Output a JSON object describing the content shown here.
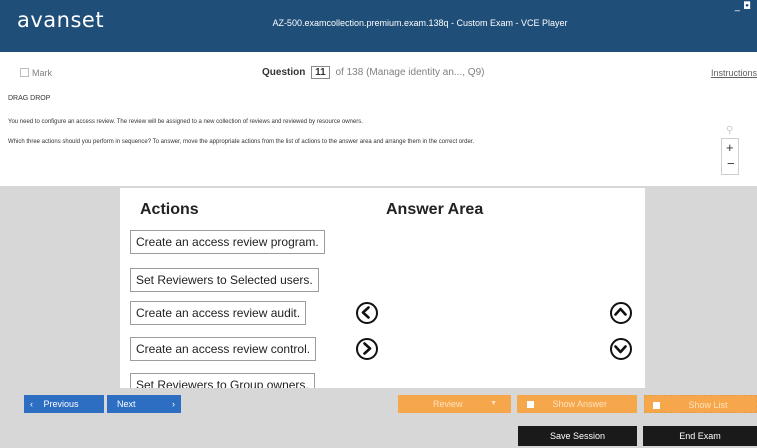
{
  "app": {
    "logo": "avanset",
    "window_title": "AZ-500.examcollection.premium.exam.138q - Custom Exam - VCE Player",
    "window_controls": "_ ◘"
  },
  "question_bar": {
    "mark_label": "Mark",
    "question_label": "Question",
    "question_number": "11",
    "question_suffix": "of 138 (Manage identity an..., Q9)",
    "instructions_label": "Instructions"
  },
  "question": {
    "type": "DRAG DROP",
    "line1": "You need to configure an access review. The review will be assigned to a new collection of reviews and reviewed by resource owners.",
    "line2": "Which three actions should you perform in sequence? To answer, move the appropriate actions from the list of actions to the answer area and arrange them in the correct order."
  },
  "zoom": {
    "search_icon": "search-icon",
    "plus": "+",
    "minus": "−"
  },
  "drag_drop": {
    "actions_heading": "Actions",
    "answer_heading": "Answer Area",
    "actions": [
      "Create an access review program.",
      "Set Reviewers to Selected users.",
      "Create an access review audit.",
      "Create an access review control.",
      "Set Reviewers to Group owners."
    ],
    "controls": [
      "arrow-left-icon",
      "arrow-right-icon",
      "arrow-up-icon",
      "arrow-down-icon"
    ]
  },
  "nav_buttons": {
    "previous": "Previous",
    "next": "Next",
    "review": "Review",
    "show_answer": "Show Answer",
    "show_list": "Show List"
  },
  "bottom_buttons": {
    "save_session": "Save Session",
    "end_exam": "End Exam"
  },
  "colors": {
    "title_bar": "#1f4e79",
    "nav_button": "#2e6ec2",
    "review_button": "#f6a74b",
    "bar_background": "#d7d7d7",
    "session_buttons": "#1a1a1a"
  }
}
